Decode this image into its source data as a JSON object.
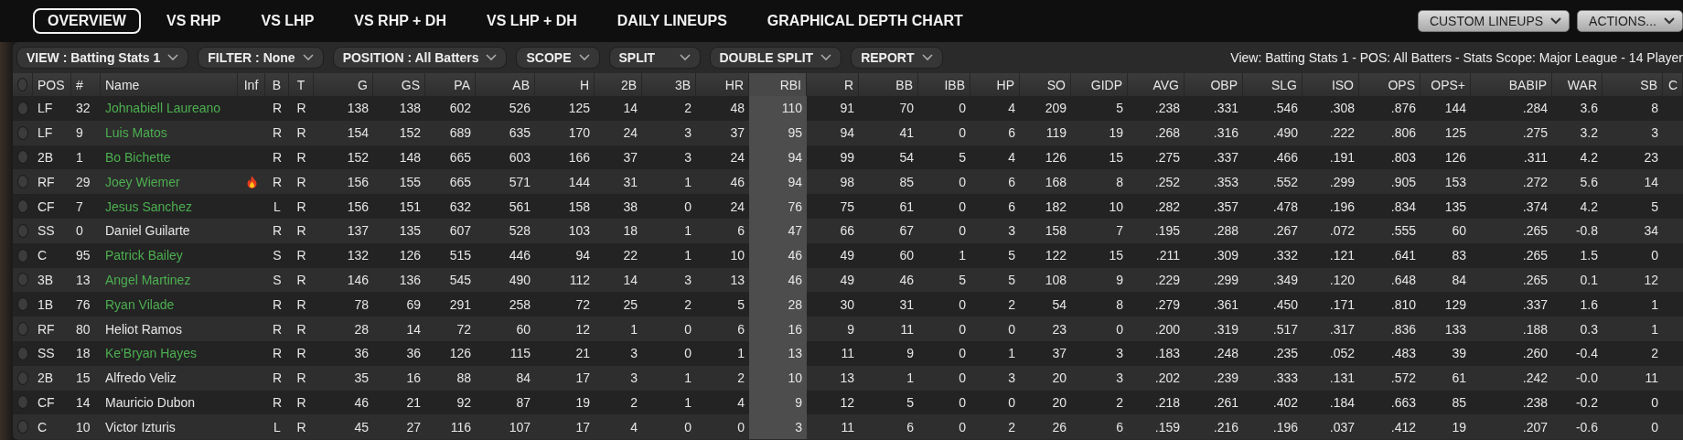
{
  "tabs": [
    {
      "label": "OVERVIEW",
      "selected": true
    },
    {
      "label": "VS RHP",
      "selected": false
    },
    {
      "label": "VS LHP",
      "selected": false
    },
    {
      "label": "VS RHP + DH",
      "selected": false
    },
    {
      "label": "VS LHP + DH",
      "selected": false
    },
    {
      "label": "DAILY LINEUPS",
      "selected": false
    },
    {
      "label": "GRAPHICAL DEPTH CHART",
      "selected": false
    }
  ],
  "menu_buttons": [
    "CUSTOM LINEUPS",
    "ACTIONS..."
  ],
  "filters": [
    "VIEW : Batting Stats 1",
    "FILTER : None",
    "POSITION : All Batters",
    "SCOPE",
    "SPLIT",
    "DOUBLE SPLIT",
    "REPORT"
  ],
  "summary": "View: Batting Stats 1 - POS: All Batters - Stats Scope: Major League - 14 Player",
  "table": {
    "all_selected": false,
    "columns": [
      {
        "label": "POS",
        "sorted": false
      },
      {
        "label": "#",
        "sorted": false
      },
      {
        "label": "Name",
        "sorted": false
      },
      {
        "label": "Inf",
        "sorted": false
      },
      {
        "label": "B",
        "sorted": false
      },
      {
        "label": "T",
        "sorted": false
      },
      {
        "label": "G",
        "sorted": false
      },
      {
        "label": "GS",
        "sorted": false
      },
      {
        "label": "PA",
        "sorted": false
      },
      {
        "label": "AB",
        "sorted": false
      },
      {
        "label": "H",
        "sorted": false
      },
      {
        "label": "2B",
        "sorted": false
      },
      {
        "label": "3B",
        "sorted": false
      },
      {
        "label": "HR",
        "sorted": false
      },
      {
        "label": "RBI",
        "sorted": true
      },
      {
        "label": "R",
        "sorted": false
      },
      {
        "label": "BB",
        "sorted": false
      },
      {
        "label": "IBB",
        "sorted": false
      },
      {
        "label": "HP",
        "sorted": false
      },
      {
        "label": "SO",
        "sorted": false
      },
      {
        "label": "GIDP",
        "sorted": false
      },
      {
        "label": "AVG",
        "sorted": false
      },
      {
        "label": "OBP",
        "sorted": false
      },
      {
        "label": "SLG",
        "sorted": false
      },
      {
        "label": "ISO",
        "sorted": false
      },
      {
        "label": "OPS",
        "sorted": false
      },
      {
        "label": "OPS+",
        "sorted": false
      },
      {
        "label": "BABIP",
        "sorted": false
      },
      {
        "label": "WAR",
        "sorted": false
      },
      {
        "label": "SB",
        "sorted": false
      },
      {
        "label": "C",
        "sorted": false
      }
    ],
    "rows": [
      {
        "selected": false,
        "pos": "LF",
        "number": "32",
        "name": "Johnabiell Laureano",
        "color": "#4caf50",
        "hot": false,
        "bats": "R",
        "throws": "R",
        "stats": [
          "138",
          "138",
          "602",
          "526",
          "125",
          "14",
          "2",
          "48",
          "110",
          "91",
          "70",
          "0",
          "4",
          "209",
          "5",
          ".238",
          ".331",
          ".546",
          ".308",
          ".876",
          "144",
          ".284",
          "3.6",
          "8"
        ]
      },
      {
        "selected": false,
        "pos": "LF",
        "number": "9",
        "name": "Luis Matos",
        "color": "#4caf50",
        "hot": false,
        "bats": "R",
        "throws": "R",
        "stats": [
          "154",
          "152",
          "689",
          "635",
          "170",
          "24",
          "3",
          "37",
          "95",
          "94",
          "41",
          "0",
          "6",
          "119",
          "19",
          ".268",
          ".316",
          ".490",
          ".222",
          ".806",
          "125",
          ".275",
          "3.2",
          "3"
        ]
      },
      {
        "selected": false,
        "pos": "2B",
        "number": "1",
        "name": "Bo Bichette",
        "color": "#4caf50",
        "hot": false,
        "bats": "R",
        "throws": "R",
        "stats": [
          "152",
          "148",
          "665",
          "603",
          "166",
          "37",
          "3",
          "24",
          "94",
          "99",
          "54",
          "5",
          "4",
          "126",
          "15",
          ".275",
          ".337",
          ".466",
          ".191",
          ".803",
          "126",
          ".311",
          "4.2",
          "23"
        ]
      },
      {
        "selected": false,
        "pos": "RF",
        "number": "29",
        "name": "Joey Wiemer",
        "color": "#4caf50",
        "hot": true,
        "bats": "R",
        "throws": "R",
        "stats": [
          "156",
          "155",
          "665",
          "571",
          "144",
          "31",
          "1",
          "46",
          "94",
          "98",
          "85",
          "0",
          "6",
          "168",
          "8",
          ".252",
          ".353",
          ".552",
          ".299",
          ".905",
          "153",
          ".272",
          "5.6",
          "14"
        ]
      },
      {
        "selected": false,
        "pos": "CF",
        "number": "7",
        "name": "Jesus Sanchez",
        "color": "#4caf50",
        "hot": false,
        "bats": "L",
        "throws": "R",
        "stats": [
          "156",
          "151",
          "632",
          "561",
          "158",
          "38",
          "0",
          "24",
          "76",
          "75",
          "61",
          "0",
          "6",
          "182",
          "10",
          ".282",
          ".357",
          ".478",
          ".196",
          ".834",
          "135",
          ".374",
          "4.2",
          "5"
        ]
      },
      {
        "selected": false,
        "pos": "SS",
        "number": "0",
        "name": "Daniel Guilarte",
        "color": "#e6e6e6",
        "hot": false,
        "bats": "R",
        "throws": "R",
        "stats": [
          "137",
          "135",
          "607",
          "528",
          "103",
          "18",
          "1",
          "6",
          "47",
          "66",
          "67",
          "0",
          "3",
          "158",
          "7",
          ".195",
          ".288",
          ".267",
          ".072",
          ".555",
          "60",
          ".265",
          "-0.8",
          "34"
        ]
      },
      {
        "selected": false,
        "pos": "C",
        "number": "95",
        "name": "Patrick Bailey",
        "color": "#4caf50",
        "hot": false,
        "bats": "S",
        "throws": "R",
        "stats": [
          "132",
          "126",
          "515",
          "446",
          "94",
          "22",
          "1",
          "10",
          "46",
          "49",
          "60",
          "1",
          "5",
          "122",
          "15",
          ".211",
          ".309",
          ".332",
          ".121",
          ".641",
          "83",
          ".265",
          "1.5",
          "0"
        ]
      },
      {
        "selected": false,
        "pos": "3B",
        "number": "13",
        "name": "Angel Martinez",
        "color": "#4caf50",
        "hot": false,
        "bats": "S",
        "throws": "R",
        "stats": [
          "146",
          "136",
          "545",
          "490",
          "112",
          "14",
          "3",
          "13",
          "46",
          "49",
          "46",
          "5",
          "5",
          "108",
          "9",
          ".229",
          ".299",
          ".349",
          ".120",
          ".648",
          "84",
          ".265",
          "0.1",
          "12"
        ]
      },
      {
        "selected": false,
        "pos": "1B",
        "number": "76",
        "name": "Ryan Vilade",
        "color": "#4caf50",
        "hot": false,
        "bats": "R",
        "throws": "R",
        "stats": [
          "78",
          "69",
          "291",
          "258",
          "72",
          "25",
          "2",
          "5",
          "28",
          "30",
          "31",
          "0",
          "2",
          "54",
          "8",
          ".279",
          ".361",
          ".450",
          ".171",
          ".810",
          "129",
          ".337",
          "1.6",
          "1"
        ]
      },
      {
        "selected": false,
        "pos": "RF",
        "number": "80",
        "name": "Heliot Ramos",
        "color": "#e6e6e6",
        "hot": false,
        "bats": "R",
        "throws": "R",
        "stats": [
          "28",
          "14",
          "72",
          "60",
          "12",
          "1",
          "0",
          "6",
          "16",
          "9",
          "11",
          "0",
          "0",
          "23",
          "0",
          ".200",
          ".319",
          ".517",
          ".317",
          ".836",
          "133",
          ".188",
          "0.3",
          "1"
        ]
      },
      {
        "selected": false,
        "pos": "SS",
        "number": "18",
        "name": "Ke'Bryan Hayes",
        "color": "#4caf50",
        "hot": false,
        "bats": "R",
        "throws": "R",
        "stats": [
          "36",
          "36",
          "126",
          "115",
          "21",
          "3",
          "0",
          "1",
          "13",
          "11",
          "9",
          "0",
          "1",
          "37",
          "3",
          ".183",
          ".248",
          ".235",
          ".052",
          ".483",
          "39",
          ".260",
          "-0.4",
          "2"
        ]
      },
      {
        "selected": false,
        "pos": "2B",
        "number": "15",
        "name": "Alfredo Veliz",
        "color": "#e6e6e6",
        "hot": false,
        "bats": "R",
        "throws": "R",
        "stats": [
          "35",
          "16",
          "88",
          "84",
          "17",
          "3",
          "1",
          "2",
          "10",
          "13",
          "1",
          "0",
          "3",
          "20",
          "3",
          ".202",
          ".239",
          ".333",
          ".131",
          ".572",
          "61",
          ".242",
          "-0.0",
          "11"
        ]
      },
      {
        "selected": false,
        "pos": "CF",
        "number": "14",
        "name": "Mauricio Dubon",
        "color": "#e6e6e6",
        "hot": false,
        "bats": "R",
        "throws": "R",
        "stats": [
          "46",
          "21",
          "92",
          "87",
          "19",
          "2",
          "1",
          "4",
          "9",
          "12",
          "5",
          "0",
          "0",
          "20",
          "2",
          ".218",
          ".261",
          ".402",
          ".184",
          ".663",
          "85",
          ".238",
          "-0.2",
          "0"
        ]
      },
      {
        "selected": false,
        "pos": "C",
        "number": "10",
        "name": "Victor Izturis",
        "color": "#e6e6e6",
        "hot": false,
        "bats": "L",
        "throws": "R",
        "stats": [
          "45",
          "27",
          "116",
          "107",
          "17",
          "4",
          "0",
          "0",
          "3",
          "11",
          "6",
          "0",
          "2",
          "26",
          "6",
          ".159",
          ".216",
          ".196",
          ".037",
          ".412",
          "19",
          ".207",
          "-0.6",
          "0"
        ]
      }
    ]
  }
}
